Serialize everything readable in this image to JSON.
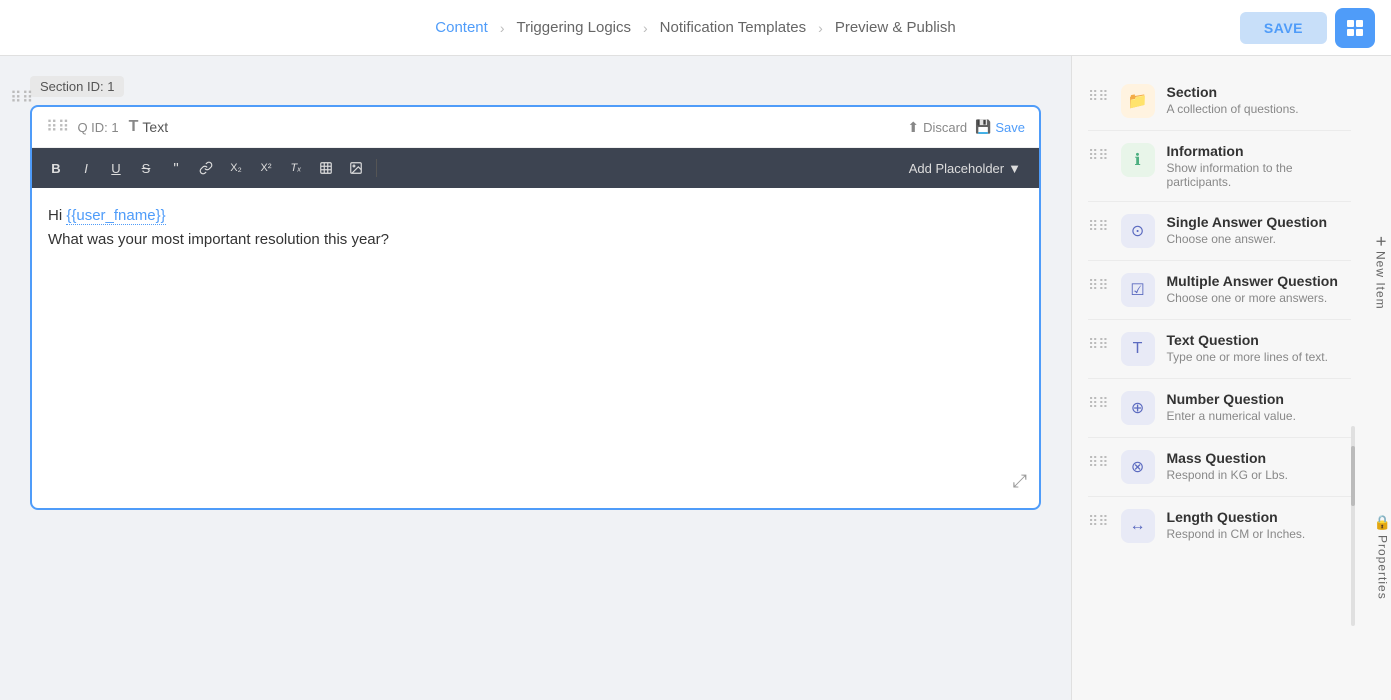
{
  "nav": {
    "steps": [
      {
        "id": "content",
        "label": "Content",
        "active": true
      },
      {
        "id": "triggering-logics",
        "label": "Triggering Logics",
        "active": false
      },
      {
        "id": "notification-templates",
        "label": "Notification Templates",
        "active": false
      },
      {
        "id": "preview-publish",
        "label": "Preview & Publish",
        "active": false
      }
    ],
    "save_label": "SAVE",
    "icon_symbol": "⊞"
  },
  "section": {
    "drag_symbol": "⠿",
    "id_label": "Section ID: 1"
  },
  "question": {
    "drag_symbol": "⠿",
    "id_label": "Q ID: 1",
    "type_icon": "T",
    "type_label": "Text",
    "discard_icon": "↑",
    "discard_label": "Discard",
    "save_icon": "💾",
    "save_label": "Save",
    "content_line1": "Hi {{user_fname}}",
    "content_line2": "What was your most important resolution this year?",
    "placeholder_variable": "{{user_fname}}",
    "expand_icon": "⤢"
  },
  "toolbar": {
    "buttons": [
      {
        "id": "bold",
        "symbol": "B",
        "label": "Bold"
      },
      {
        "id": "italic",
        "symbol": "I",
        "label": "Italic"
      },
      {
        "id": "underline",
        "symbol": "U",
        "label": "Underline"
      },
      {
        "id": "strikethrough",
        "symbol": "S̶",
        "label": "Strikethrough"
      },
      {
        "id": "quote",
        "symbol": "❝",
        "label": "Blockquote"
      },
      {
        "id": "link",
        "symbol": "🔗",
        "label": "Link"
      },
      {
        "id": "subscript",
        "symbol": "X₂",
        "label": "Subscript"
      },
      {
        "id": "superscript",
        "symbol": "X²",
        "label": "Superscript"
      },
      {
        "id": "clear",
        "symbol": "Tₓ",
        "label": "Clear Format"
      },
      {
        "id": "table",
        "symbol": "⊞",
        "label": "Table"
      },
      {
        "id": "image",
        "symbol": "🖼",
        "label": "Image"
      }
    ],
    "placeholder_label": "Add Placeholder",
    "placeholder_arrow": "▼"
  },
  "sidebar": {
    "new_item_plus": "+",
    "new_item_label": "New Item",
    "properties_icon": "🔒",
    "properties_label": "Properties",
    "items": [
      {
        "id": "section",
        "icon": "📁",
        "icon_class": "icon-section",
        "title": "Section",
        "description": "A collection of questions."
      },
      {
        "id": "information",
        "icon": "ℹ",
        "icon_class": "icon-info",
        "title": "Information",
        "description": "Show information to the participants."
      },
      {
        "id": "single-answer",
        "icon": "⊙",
        "icon_class": "icon-single",
        "title": "Single Answer Question",
        "description": "Choose one answer."
      },
      {
        "id": "multiple-answer",
        "icon": "☑",
        "icon_class": "icon-multiple",
        "title": "Multiple Answer Question",
        "description": "Choose one or more answers."
      },
      {
        "id": "text-question",
        "icon": "T",
        "icon_class": "icon-text",
        "title": "Text Question",
        "description": "Type one or more lines of text."
      },
      {
        "id": "number-question",
        "icon": "⊕",
        "icon_class": "icon-number",
        "title": "Number Question",
        "description": "Enter a numerical value."
      },
      {
        "id": "mass-question",
        "icon": "⊗",
        "icon_class": "icon-mass",
        "title": "Mass Question",
        "description": "Respond in KG or Lbs."
      },
      {
        "id": "length-question",
        "icon": "↔",
        "icon_class": "icon-length",
        "title": "Length Question",
        "description": "Respond in CM or Inches."
      }
    ]
  }
}
